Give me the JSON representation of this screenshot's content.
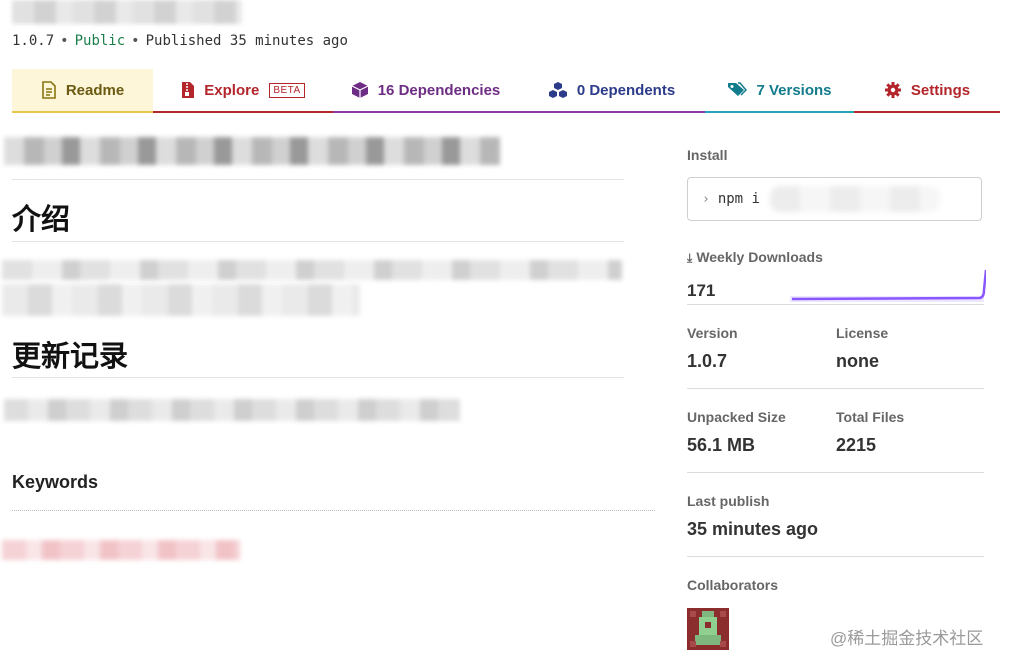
{
  "package": {
    "version": "1.0.7",
    "visibility": "Public",
    "published": "Published 35 minutes ago"
  },
  "tabs": [
    {
      "label": "Readme",
      "icon": "readme-icon"
    },
    {
      "label": "Explore",
      "badge": "BETA",
      "icon": "zip-file-icon"
    },
    {
      "label": "16 Dependencies",
      "icon": "box-icon"
    },
    {
      "label": "0 Dependents",
      "icon": "boxes-icon"
    },
    {
      "label": "7 Versions",
      "icon": "tags-icon"
    },
    {
      "label": "Settings",
      "icon": "gear-icon"
    }
  ],
  "readme": {
    "section1": "介绍",
    "section2": "更新记录",
    "keywords": "Keywords"
  },
  "sidebar": {
    "install_label": "Install",
    "install_command": "npm i",
    "weekly_label": "Weekly Downloads",
    "weekly_value": "171",
    "version_label": "Version",
    "version_value": "1.0.7",
    "license_label": "License",
    "license_value": "none",
    "unpacked_label": "Unpacked Size",
    "unpacked_value": "56.1 MB",
    "files_label": "Total Files",
    "files_value": "2215",
    "last_publish_label": "Last publish",
    "last_publish_value": "35 minutes ago",
    "collaborators_label": "Collaborators"
  },
  "watermark": "@稀土掘金技术社区",
  "colors": {
    "readme_accent": "#e8c64a",
    "explore_accent": "#b3262b",
    "deps_accent": "#8a3aa3",
    "versions_accent": "#27a3b8",
    "sparkline": "#8956ff"
  }
}
